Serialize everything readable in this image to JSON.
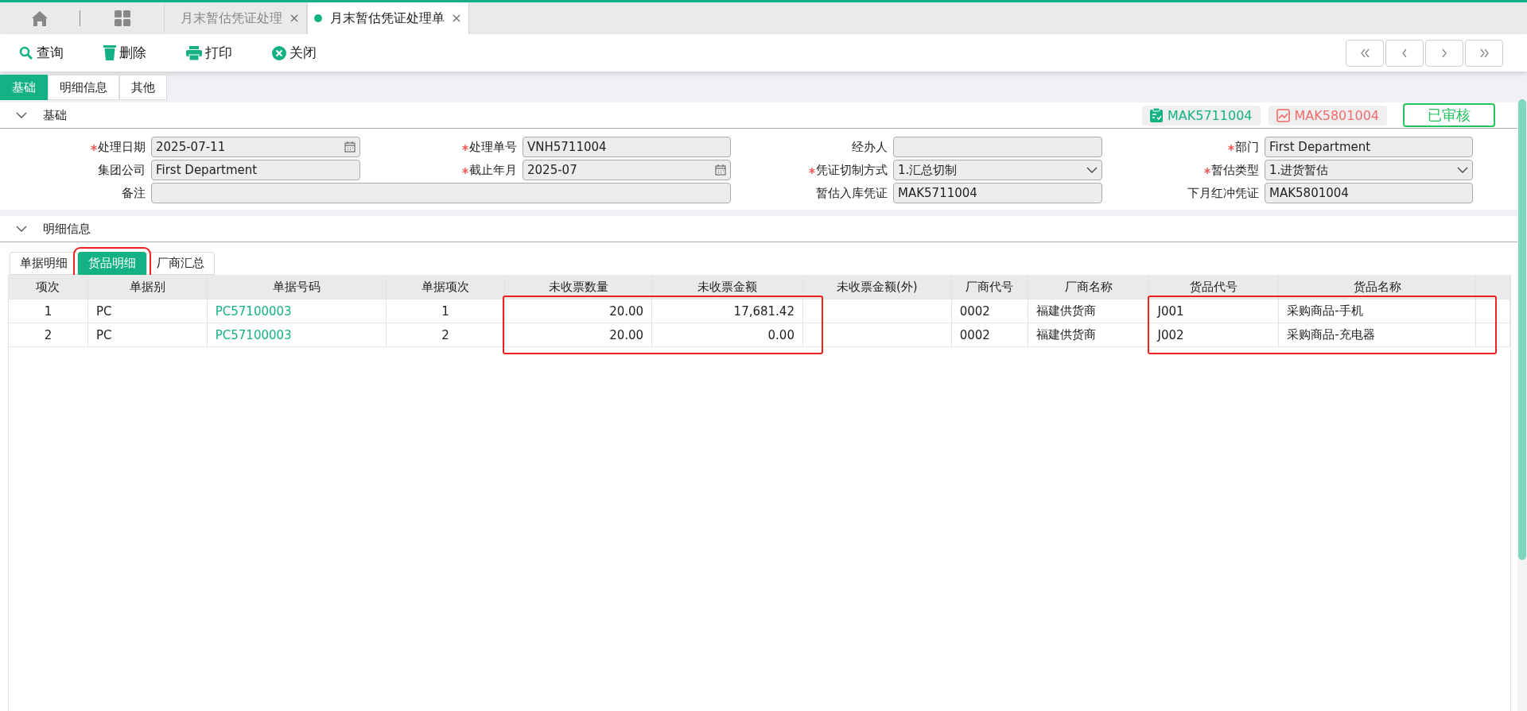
{
  "window_tabs": [
    {
      "label": "月末暂估凭证处理",
      "selected": false
    },
    {
      "label": "月末暂估凭证处理单",
      "selected": true
    }
  ],
  "toolbar": [
    {
      "kind": "search",
      "label": "查询"
    },
    {
      "kind": "delete",
      "label": "删除"
    },
    {
      "kind": "print",
      "label": "打印"
    },
    {
      "kind": "close",
      "label": "关闭"
    }
  ],
  "nav_buttons": [
    {
      "kind": "first"
    },
    {
      "kind": "prev"
    },
    {
      "kind": "next"
    },
    {
      "kind": "last"
    }
  ],
  "section_tabs": [
    {
      "label": "基础",
      "selected": true
    },
    {
      "label": "明细信息",
      "selected": false
    },
    {
      "label": "其他",
      "selected": false
    }
  ],
  "basic": {
    "title": "基础",
    "expanded": true,
    "badges": [
      {
        "kind": "entry",
        "text": "MAK5711004"
      },
      {
        "kind": "reversal",
        "text": "MAK5801004"
      }
    ],
    "status": "已审核",
    "fields": [
      {
        "label": "处理日期",
        "required": true,
        "kind": "date",
        "value": "2025-07-11"
      },
      {
        "label": "处理单号",
        "required": true,
        "kind": "text",
        "value": "VNH5711004"
      },
      {
        "label": "经办人",
        "required": false,
        "kind": "text"
      },
      {
        "label": "部门",
        "required": true,
        "kind": "text",
        "value": "First Department"
      },
      {
        "label": "集团公司",
        "required": false,
        "kind": "text",
        "value": "First Department"
      },
      {
        "label": "截止年月",
        "required": true,
        "kind": "date",
        "value": "2025-07"
      },
      {
        "label": "凭证切制方式",
        "required": true,
        "kind": "select",
        "value": "1.汇总切制"
      },
      {
        "label": "暂估类型",
        "required": true,
        "kind": "select",
        "value": "1.进货暂估"
      },
      {
        "label": "备注",
        "required": false,
        "kind": "wide"
      },
      {
        "label": "暂估入库凭证",
        "required": false,
        "kind": "text",
        "value": "MAK5711004"
      },
      {
        "label": "下月红冲凭证",
        "required": false,
        "kind": "text",
        "value": "MAK5801004"
      }
    ]
  },
  "detail": {
    "title": "明细信息",
    "expanded": true,
    "tabs": [
      {
        "label": "单据明细",
        "selected": false,
        "highlighted": false
      },
      {
        "label": "货品明细",
        "selected": true,
        "highlighted": true
      },
      {
        "label": "厂商汇总",
        "selected": false,
        "highlighted": false
      }
    ],
    "columns": [
      {
        "label": "项次",
        "kind": "center",
        "highlighted": false
      },
      {
        "label": "单据别",
        "kind": "text",
        "highlighted": false
      },
      {
        "label": "单据号码",
        "kind": "link",
        "highlighted": false
      },
      {
        "label": "单据项次",
        "kind": "center",
        "highlighted": false
      },
      {
        "label": "未收票数量",
        "kind": "number",
        "highlighted": true
      },
      {
        "label": "未收票金额",
        "kind": "number",
        "highlighted": true
      },
      {
        "label": "未收票金额(外)",
        "kind": "number",
        "highlighted": false
      },
      {
        "label": "厂商代号",
        "kind": "text",
        "highlighted": false
      },
      {
        "label": "厂商名称",
        "kind": "text",
        "highlighted": false
      },
      {
        "label": "货品代号",
        "kind": "text",
        "highlighted": true
      },
      {
        "label": "货品名称",
        "kind": "text",
        "highlighted": true
      }
    ],
    "rows": [
      [
        "1",
        "PC",
        "PC57100003",
        "1",
        "20.00",
        "17,681.42",
        "",
        "0002",
        "福建供货商",
        "J001",
        "采购商品-手机"
      ],
      [
        "2",
        "PC",
        "PC57100003",
        "2",
        "20.00",
        "0.00",
        "",
        "0002",
        "福建供货商",
        "J002",
        "采购商品-充电器"
      ]
    ]
  }
}
